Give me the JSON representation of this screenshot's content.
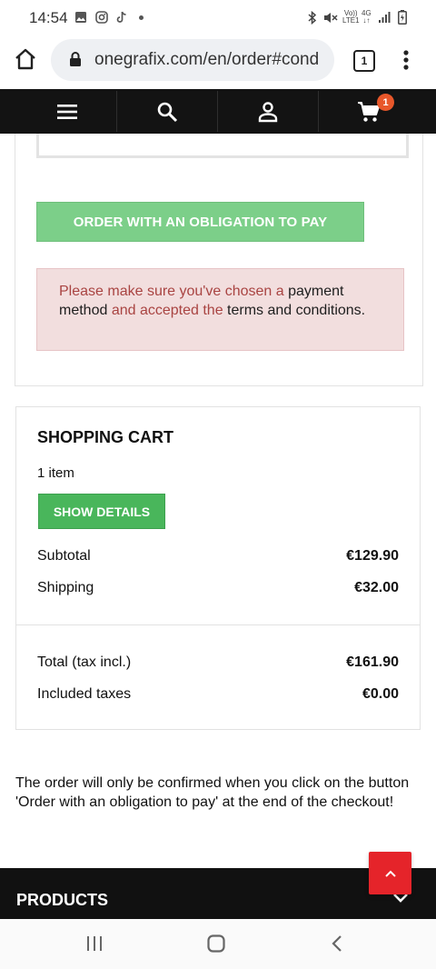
{
  "status_bar": {
    "time": "14:54",
    "icons": [
      "gallery-icon",
      "instagram-icon",
      "tiktok-icon",
      "dot-icon",
      "bluetooth-icon",
      "mute-icon",
      "volte-icon",
      "4g-icon",
      "signal-icon",
      "battery-icon"
    ],
    "network_top": "Vo))",
    "network_bottom": "LTE1",
    "network_type": "4G"
  },
  "browser": {
    "url": "onegrafix.com/en/order#cond",
    "tab_count": "1"
  },
  "site_nav": {
    "cart_count": "1",
    "icons": [
      "menu-icon",
      "search-icon",
      "account-icon",
      "cart-icon"
    ]
  },
  "checkout": {
    "order_button": "ORDER WITH AN OBLIGATION TO PAY",
    "alert": {
      "part1": "Please make sure you've chosen a ",
      "link1": "payment method",
      "part2": " and accepted the ",
      "link2": "terms and conditions",
      "part3": "."
    }
  },
  "cart": {
    "title": "SHOPPING CART",
    "items_count": "1 item",
    "show_details": "SHOW DETAILS",
    "subtotal_label": "Subtotal",
    "subtotal_value": "€129.90",
    "shipping_label": "Shipping",
    "shipping_value": "€32.00",
    "total_label": "Total (tax incl.)",
    "total_value": "€161.90",
    "taxes_label": "Included taxes",
    "taxes_value": "€0.00"
  },
  "notice": "The order will only be confirmed when you click on the button 'Order with an obligation to pay' at the end of the checkout!",
  "footer": {
    "products_title": "PRODUCTS"
  },
  "colors": {
    "nav_bg": "#131313",
    "badge": "#e8572a",
    "order_button": "#7ccf89",
    "show_details": "#49b65b",
    "alert_bg": "#f2dede",
    "alert_text": "#a94442",
    "back_to_top": "#e5242a"
  }
}
